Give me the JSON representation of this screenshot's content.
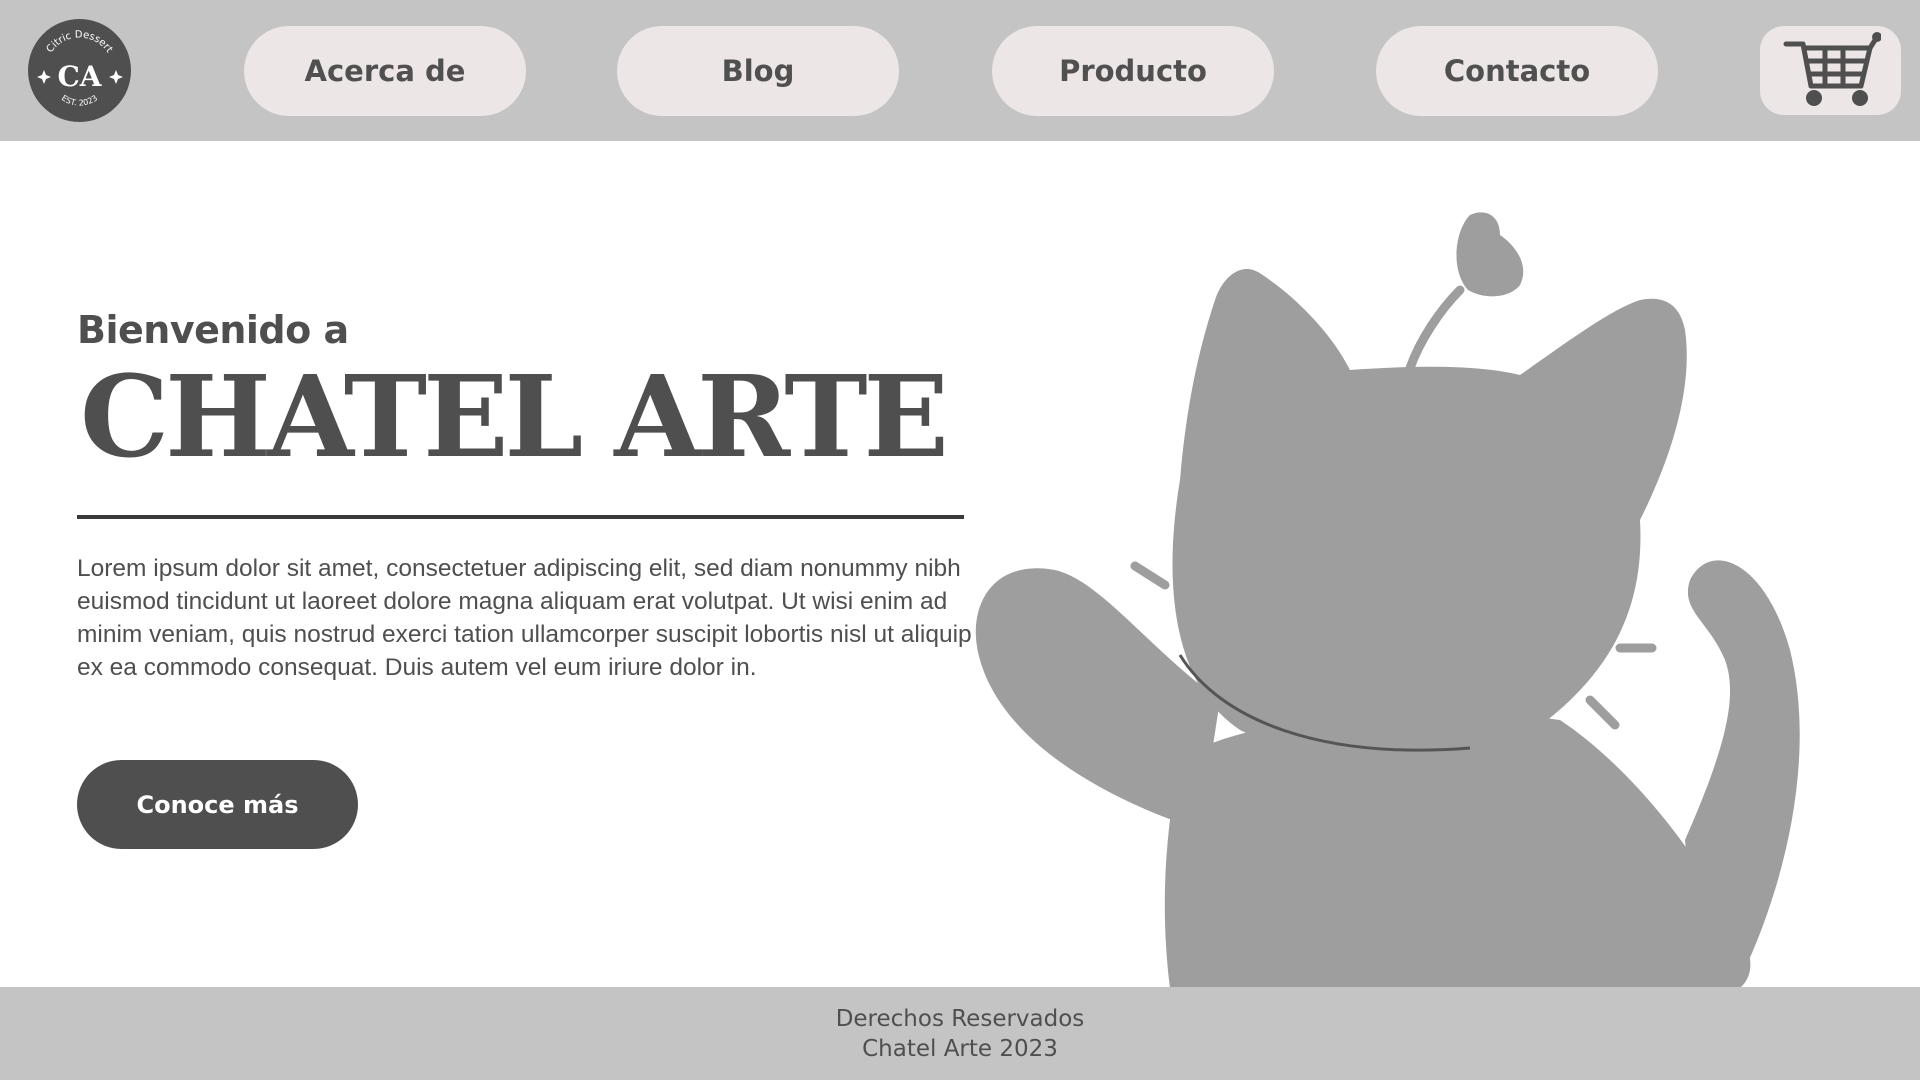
{
  "logo": {
    "top_text": "Citric Dessert",
    "monogram": "CA",
    "bottom_text": "EST. 2023"
  },
  "nav": {
    "items": [
      {
        "label": "Acerca de"
      },
      {
        "label": "Blog"
      },
      {
        "label": "Producto"
      },
      {
        "label": "Contacto"
      }
    ],
    "cart_icon": "shopping-cart-icon"
  },
  "hero": {
    "welcome": "Bienvenido a",
    "title": "CHATEL ARTE",
    "body": "Lorem ipsum dolor sit amet, consectetuer adipiscing elit, sed diam nonummy nibh euismod tincidunt ut laoreet dolore magna aliquam erat volutpat. Ut wisi enim ad minim veniam, quis nostrud exerci tation ullamcorper suscipit lobortis nisl ut aliquip ex ea commodo consequat. Duis autem vel eum iriure dolor in.",
    "cta_label": "Conoce más"
  },
  "footer": {
    "line1": "Derechos Reservados",
    "line2": "Chatel Arte 2023"
  },
  "colors": {
    "header_bg": "#c4c4c4",
    "nav_button_bg": "#ece6e6",
    "text_dark": "#4f4f4f",
    "cat_fill": "#9e9e9e",
    "cta_bg": "#4f4f4f"
  }
}
